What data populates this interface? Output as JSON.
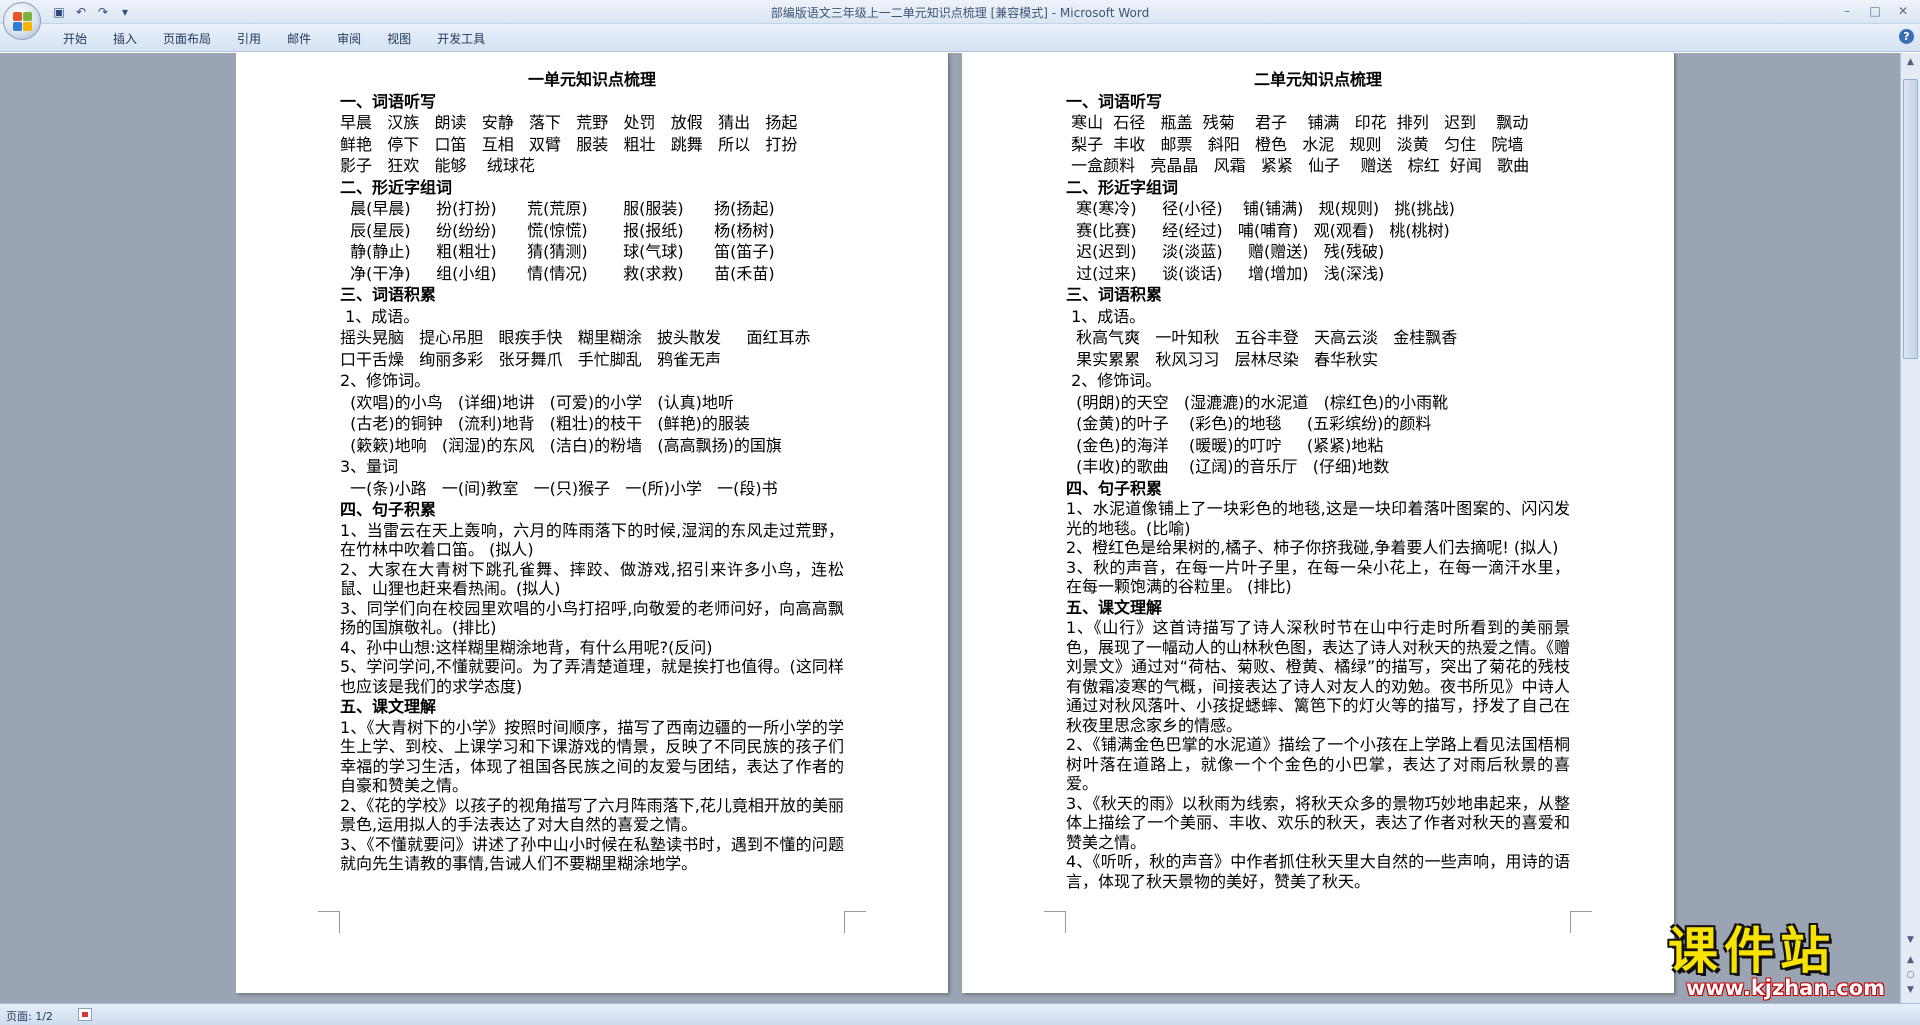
{
  "window": {
    "title": "部编版语文三年级上一二单元知识点梳理 [兼容模式] - Microsoft Word"
  },
  "ribbon": {
    "tabs": [
      "开始",
      "插入",
      "页面布局",
      "引用",
      "邮件",
      "审阅",
      "视图",
      "开发工具"
    ]
  },
  "status": {
    "page": "页面: 1/2"
  },
  "watermark": {
    "brand": "课件站",
    "url": "www.kjzhan.com"
  },
  "page1": {
    "title": "一单元知识点梳理",
    "lines": [
      {
        "t": "一、词语听写",
        "b": true
      },
      {
        "t": "早晨   汉族   朗读   安静   落下   荒野   处罚   放假   猜出   扬起"
      },
      {
        "t": "鲜艳   停下   口笛   互相   双臂   服装   粗壮   跳舞   所以   打扮"
      },
      {
        "t": "影子   狂欢   能够    绒球花"
      },
      {
        "t": "二、形近字组词",
        "b": true
      },
      {
        "t": "  晨(早晨)     扮(打扮)      荒(荒原)       服(服装)      扬(扬起)"
      },
      {
        "t": "  辰(星辰)     纷(纷纷)      慌(惊慌)       报(报纸)      杨(杨树)"
      },
      {
        "t": "  静(静止)     粗(粗壮)      猜(猜测)       球(气球)      笛(笛子)"
      },
      {
        "t": "  净(干净)     组(小组)      情(情况)       救(求救)      苗(禾苗)"
      },
      {
        "t": "三、词语积累",
        "b": true
      },
      {
        "t": " 1、成语。"
      },
      {
        "t": "摇头晃脑   提心吊胆   眼疾手快   糊里糊涂   披头散发     面红耳赤"
      },
      {
        "t": "口干舌燥   绚丽多彩   张牙舞爪   手忙脚乱   鸦雀无声"
      },
      {
        "t": "2、修饰词。"
      },
      {
        "t": "  (欢唱)的小鸟   (详细)地讲   (可爱)的小学   (认真)地听"
      },
      {
        "t": "  (古老)的铜钟   (流利)地背   (粗壮)的枝干   (鲜艳)的服装"
      },
      {
        "t": "  (簌簌)地响   (润湿)的东风   (洁白)的粉墙   (高高飘扬)的国旗"
      },
      {
        "t": "3、量词"
      },
      {
        "t": "  一(条)小路   一(间)教室   一(只)猴子   一(所)小学   一(段)书"
      },
      {
        "t": "四、句子积累",
        "b": true
      }
    ],
    "paras": [
      "    1、当雷云在天上轰响，六月的阵雨落下的时候,湿润的东风走过荒野，在竹林中吹着口笛。 (拟人)",
      "    2、大家在大青树下跳孔雀舞、摔跤、做游戏,招引来许多小鸟，连松鼠、山狸也赶来看热闹。(拟人)",
      "    3、同学们向在校园里欢唱的小鸟打招呼,向敬爱的老师问好，向高高飘扬的国旗敬礼。(排比)",
      "    4、孙中山想:这样糊里糊涂地背，有什么用呢?(反问)",
      "    5、学问学问,不懂就要问。为了弄清楚道理，就是挨打也值得。(这同样也应该是我们的求学态度)"
    ],
    "section5": "五、课文理解",
    "paras2": [
      "    1、《大青树下的小学》按照时间顺序，描写了西南边疆的一所小学的学生上学、到校、上课学习和下课游戏的情景，反映了不同民族的孩子们幸福的学习生活，体现了祖国各民族之间的友爱与团结，表达了作者的自豪和赞美之情。",
      "    2、《花的学校》以孩子的视角描写了六月阵雨落下,花儿竟相开放的美丽景色,运用拟人的手法表达了对大自然的喜爱之情。",
      "    3、《不懂就要问》讲述了孙中山小时候在私塾读书时，遇到不懂的问题就向先生请教的事情,告诫人们不要糊里糊涂地学。"
    ]
  },
  "page2": {
    "title": "二单元知识点梳理",
    "lines": [
      {
        "t": "一、词语听写",
        "b": true
      },
      {
        "t": " 寒山  石径   瓶盖  残菊    君子    铺满   印花  排列   迟到    飘动"
      },
      {
        "t": " 梨子  丰收   邮票   斜阳   橙色   水泥   规则   淡黄   匀住   院墙"
      },
      {
        "t": " 一盒颜料   亮晶晶   风霜   紧紧   仙子    赠送   棕红  好闻   歌曲"
      },
      {
        "t": "二、形近字组词",
        "b": true
      },
      {
        "t": "  寒(寒冷)     径(小径)    铺(铺满)   规(规则)   挑(挑战)"
      },
      {
        "t": "  赛(比赛)     经(经过)   哺(哺育)   观(观看)   桃(桃树)"
      },
      {
        "t": "  迟(迟到)     淡(淡蓝)     赠(赠送)   残(残破)"
      },
      {
        "t": "  过(过来)     谈(谈话)     增(增加)   浅(深浅)"
      },
      {
        "t": "三、词语积累",
        "b": true
      },
      {
        "t": " 1、成语。"
      },
      {
        "t": "  秋高气爽   一叶知秋   五谷丰登   天高云淡   金桂飘香"
      },
      {
        "t": "  果实累累   秋风习习   层林尽染   春华秋实"
      },
      {
        "t": " 2、修饰词。"
      },
      {
        "t": "  (明朗)的天空   (湿漉漉)的水泥道   (棕红色)的小雨靴"
      },
      {
        "t": "  (金黄)的叶子    (彩色)的地毯     (五彩缤纷)的颜料"
      },
      {
        "t": "  (金色)的海洋    (暖暖)的叮咛     (紧紧)地粘"
      },
      {
        "t": "  (丰收)的歌曲    (辽阔)的音乐厅   (仔细)地数"
      },
      {
        "t": "四、句子积累",
        "b": true
      }
    ],
    "paras": [
      "    1、水泥道像铺上了一块彩色的地毯,这是一块印着落叶图案的、闪闪发光的地毯。(比喻)",
      "    2、橙红色是给果树的,橘子、柿子你挤我碰,争着要人们去摘呢! (拟人)",
      "    3、秋的声音，在每一片叶子里，在每一朵小花上，在每一滴汗水里，在每一颗饱满的谷粒里。 (排比)"
    ],
    "section5": "五、课文理解",
    "paras2": [
      "    1、《山行》这首诗描写了诗人深秋时节在山中行走时所看到的美丽景色，展现了一幅动人的山林秋色图，表达了诗人对秋天的热爱之情。《赠刘景文》通过对“荷枯、菊败、橙黄、橘绿”的描写，突出了菊花的残枝有傲霜凌寒的气概，间接表达了诗人对友人的劝勉。夜书所见》中诗人通过对秋风落叶、小孩捉蟋蟀、篱笆下的灯火等的描写，抒发了自己在秋夜里思念家乡的情感。",
      "    2、《铺满金色巴掌的水泥道》描绘了一个小孩在上学路上看见法国梧桐树叶落在道路上，就像一个个金色的小巴掌，表达了对雨后秋景的喜爱。",
      "    3、《秋天的雨》以秋雨为线索，将秋天众多的景物巧妙地串起来，从整体上描绘了一个美丽、丰收、欢乐的秋天，表达了作者对秋天的喜爱和赞美之情。",
      "    4、《听听，秋的声音》中作者抓住秋天里大自然的一些声响，用诗的语言，体现了秋天景物的美好，赞美了秋天。"
    ]
  }
}
